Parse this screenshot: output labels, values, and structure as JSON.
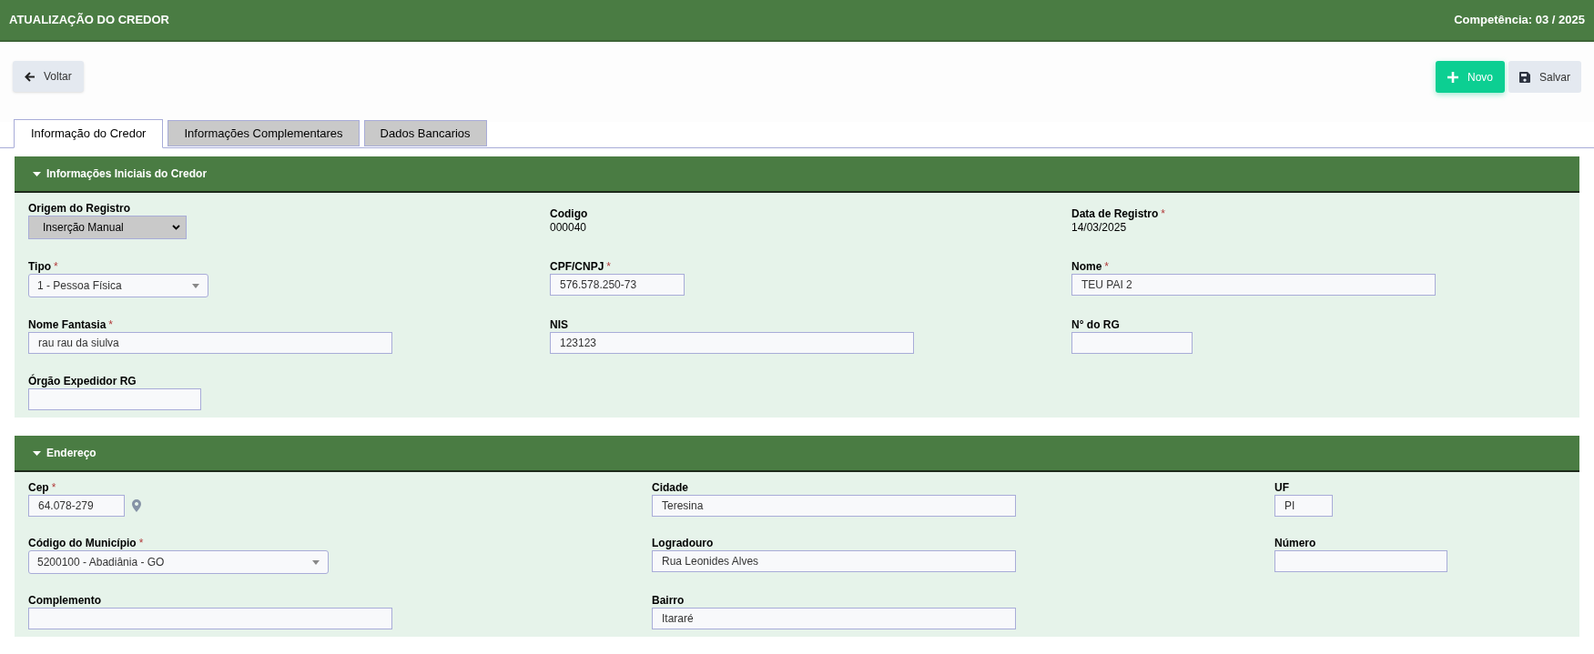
{
  "header": {
    "title": "ATUALIZAÇÃO DO CREDOR",
    "period": "Competência: 03 / 2025"
  },
  "toolbar": {
    "back": "Voltar",
    "new": "Novo",
    "save": "Salvar"
  },
  "tabs": [
    {
      "label": "Informação do Credor",
      "selected": true
    },
    {
      "label": "Informações Complementares",
      "selected": false
    },
    {
      "label": "Dados Bancarios",
      "selected": false
    }
  ],
  "sections": [
    {
      "title": "Informações Iniciais do Credor",
      "expanded": true,
      "fields": [
        {
          "kind": "select",
          "label": "Origem do Registro",
          "value": "Inserção Manual"
        },
        {
          "kind": "readonly",
          "label": "Codigo",
          "value": "000040"
        },
        {
          "kind": "readonly",
          "label": "Data de Registro",
          "required_mark": "*",
          "value": "14/03/2025"
        },
        {
          "kind": "combo",
          "label": "Tipo",
          "required_mark": "*",
          "value": "1 - Pessoa Física"
        },
        {
          "kind": "text",
          "label": "CPF/CNPJ",
          "required_mark": "*",
          "value": "576.578.250-73"
        },
        {
          "kind": "text",
          "label": "Nome",
          "required_mark": "*",
          "value": "TEU PAI 2"
        },
        {
          "kind": "text",
          "label": "Nome Fantasia",
          "required_mark": "*",
          "value": "rau rau da siulva"
        },
        {
          "kind": "text",
          "label": "NIS",
          "value": "123123"
        },
        {
          "kind": "text",
          "label": "N° do RG"
        },
        {
          "kind": "text",
          "label": "Órgão Expedidor RG"
        }
      ]
    },
    {
      "title": "Endereço",
      "expanded": true,
      "fields": [
        {
          "kind": "cep",
          "label": "Cep",
          "required_mark": "*",
          "value": "64.078-279"
        },
        {
          "kind": "text",
          "label": "Cidade",
          "value": "Teresina"
        },
        {
          "kind": "text",
          "label": "UF",
          "value": "PI"
        },
        {
          "kind": "combo",
          "label": "Código do Município",
          "required_mark": "*",
          "value": "5200100 - Abadiânia - GO"
        },
        {
          "kind": "text",
          "label": "Logradouro",
          "value": "Rua Leonides Alves"
        },
        {
          "kind": "text",
          "label": "Número"
        },
        {
          "kind": "text",
          "label": "Complemento"
        },
        {
          "kind": "text",
          "label": "Bairro",
          "value": "Itararé"
        }
      ]
    }
  ]
}
